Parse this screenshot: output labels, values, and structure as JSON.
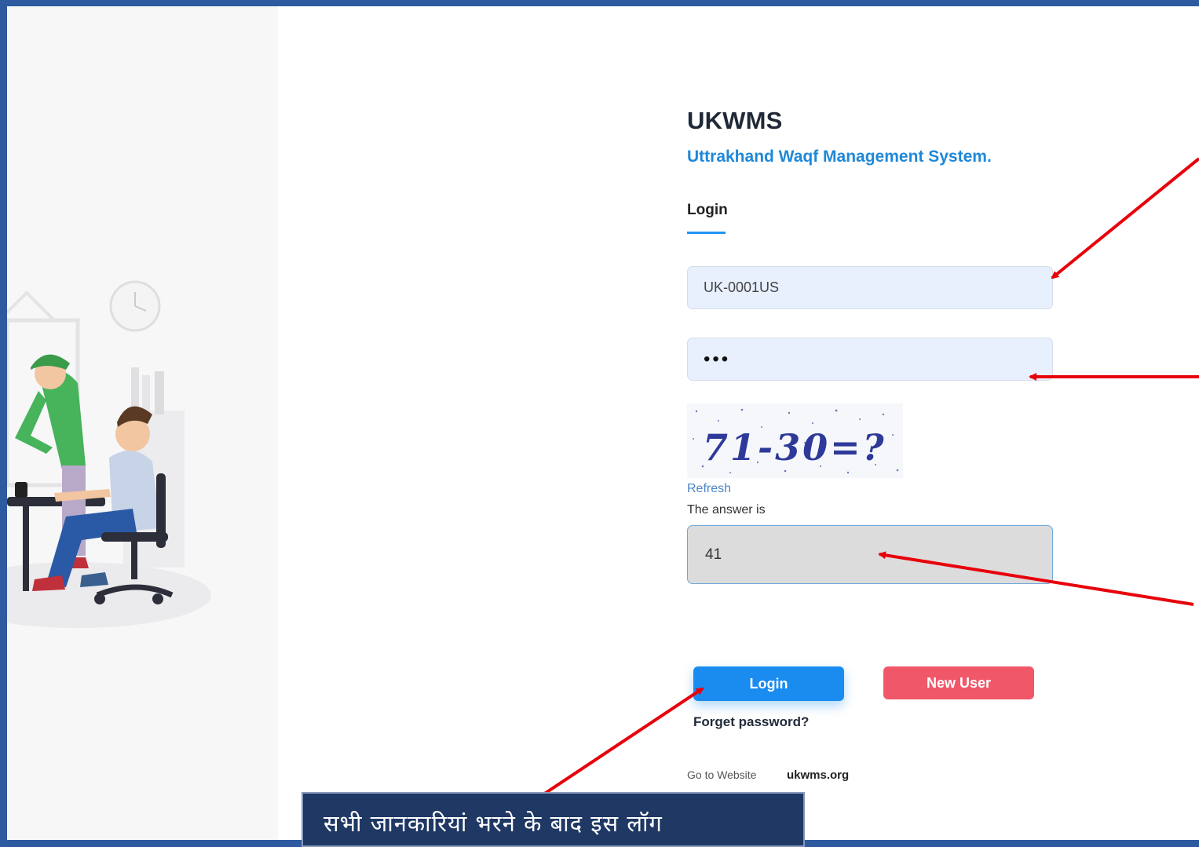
{
  "brand": {
    "title": "UKWMS",
    "subtitle": "Uttrakhand Waqf Management System."
  },
  "login_tab": {
    "label": "Login"
  },
  "form": {
    "username_value": "UK-0001US",
    "password_masked": "•••",
    "captcha_text": "71-30=?",
    "refresh_label": "Refresh",
    "answer_label": "The answer is",
    "answer_value": "41"
  },
  "buttons": {
    "login_label": "Login",
    "new_user_label": "New User"
  },
  "links": {
    "forget_password": "Forget password?",
    "go_to_website": "Go to Website",
    "website": "ukwms.org"
  },
  "caption": {
    "text": "सभी जानकारियां भरने के बाद इस लॉग"
  },
  "colors": {
    "accent": "#1e88d8",
    "login_button": "#1a8cf0",
    "new_user_button": "#f0586a",
    "annotation_arrow": "#e8000b",
    "caption_bg": "#1f3864",
    "outer_border": "#2e5aa0"
  }
}
